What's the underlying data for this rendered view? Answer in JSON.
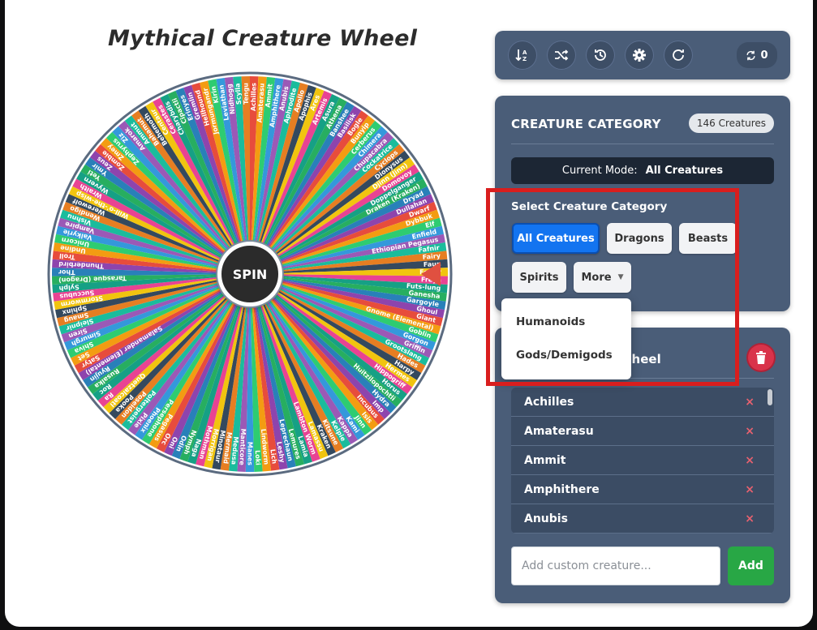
{
  "title": "Mythical Creature Wheel",
  "wheel": {
    "spin_label": "SPIN",
    "colors": [
      "#e74c3c",
      "#f39c12",
      "#2ecc71",
      "#3498db",
      "#9b59b6",
      "#1abc9c",
      "#e67e22",
      "#34495e",
      "#f1c40f",
      "#e84393",
      "#16a085",
      "#27ae60",
      "#2980b9",
      "#8e44ad"
    ],
    "segments": [
      "Achilles",
      "Amaterasu",
      "Ammit",
      "Amphithere",
      "Anubis",
      "Aphrodite",
      "Apollo",
      "Apophis",
      "Ares",
      "Artemis",
      "Asura",
      "Athena",
      "Banshee",
      "Basilisk",
      "Bogle",
      "Bunyip",
      "Cerberus",
      "Chimera",
      "Chupacabra",
      "Cockatrice",
      "Cyclops",
      "Dionysus",
      "Djinn (Jinn)",
      "Domovoy",
      "Doppelganger",
      "Draken (Kraken)",
      "Dryad",
      "Dullahan",
      "Dwarf",
      "Dybbuk",
      "Elf",
      "Enfield",
      "Ethiopian Pegasus",
      "Fafnir",
      "Fairy",
      "Faun",
      "Fenrir",
      "Freya",
      "Futs-lung",
      "Ganesha",
      "Gargoyle",
      "Ghoul",
      "Giant",
      "Gnome (Elemental)",
      "Goblin",
      "Gorgon",
      "Griffin",
      "Grootslang",
      "Hades",
      "Harpy",
      "Hermes",
      "Hippogriff",
      "Horus",
      "Huitzilopochtli",
      "Hydra",
      "Imp",
      "Incubus",
      "Isis",
      "Jinn",
      "Kami",
      "Kappa",
      "Kelpie",
      "Kitsune",
      "Kraken",
      "Lamassu",
      "Lambton Worm",
      "Lamia",
      "Lemures",
      "Leprechaun",
      "Leshy",
      "Lich",
      "Lindworm",
      "Loki",
      "Manes",
      "Manticore",
      "Medusa",
      "Mermaid",
      "Minotaur",
      "Morrigan",
      "Mothman",
      "Naga",
      "Nymph",
      "Odin",
      "Oni",
      "Orc",
      "Pegasus",
      "Persephone",
      "Phoenix",
      "Pixie",
      "Poltergeist",
      "Poseidon",
      "Pooka",
      "Quetzalcoatl",
      "Ra",
      "Roc",
      "Rusalka",
      "Ryujin",
      "Salamander (Elemental)",
      "Satyr",
      "Set",
      "Shiva",
      "Simurgh",
      "Siren",
      "Sleipnir",
      "Smaug",
      "Sphinx",
      "Stormworm",
      "Succubus",
      "Sylph",
      "Tarasque (Dragon)",
      "Thor",
      "Thunderbird",
      "Troll",
      "Undine",
      "Unicorn",
      "Valkyrie",
      "Vampire",
      "Vishnu",
      "Wendigo",
      "Werewolf",
      "Will-o'-the-wisp",
      "Wraith",
      "Wyvern",
      "Yeti",
      "Ymir",
      "Zeus",
      "Zombie",
      "Zmey",
      "Zephyrus",
      "Ziz",
      "Amarok",
      "Ammut",
      "Bahamut",
      "Behemoth",
      "Centaur",
      "Cerastes",
      "Charybdis",
      "Cipactli",
      "Erinyes",
      "Gremlin",
      "Hellhound",
      "Jormungandr",
      "Kirin",
      "Leviathan",
      "Nidhogg",
      "Scylla",
      "Tengu"
    ]
  },
  "toolbar": {
    "buttons": [
      {
        "icon": "sort-az-icon",
        "label": "Sort"
      },
      {
        "icon": "shuffle-icon",
        "label": "Shuffle"
      },
      {
        "icon": "history-icon",
        "label": "History"
      },
      {
        "icon": "gear-icon",
        "label": "Settings"
      },
      {
        "icon": "redo-icon",
        "label": "Reset"
      }
    ],
    "counter": "0"
  },
  "category": {
    "title": "CREATURE CATEGORY",
    "count_badge": "146 Creatures",
    "current_mode_label": "Current Mode:",
    "current_mode_value": "All Creatures",
    "select_label": "Select Creature Category",
    "buttons": [
      "All Creatures",
      "Dragons",
      "Beasts",
      "Spirits"
    ],
    "more_label": "More",
    "dropdown_items": [
      "Humanoids",
      "Gods/Demigods"
    ]
  },
  "wheel_list": {
    "title_visible_fragment": "Wheel",
    "items": [
      "Achilles",
      "Amaterasu",
      "Ammit",
      "Amphithere",
      "Anubis"
    ],
    "remove_glyph": "×",
    "input_placeholder": "Add custom creature...",
    "add_label": "Add"
  },
  "colors": {
    "panel": "#4a5d78",
    "accent_blue": "#1374f0",
    "add_green": "#28a745",
    "trash_red": "#d9334a",
    "highlight_red": "#d91e1e"
  }
}
